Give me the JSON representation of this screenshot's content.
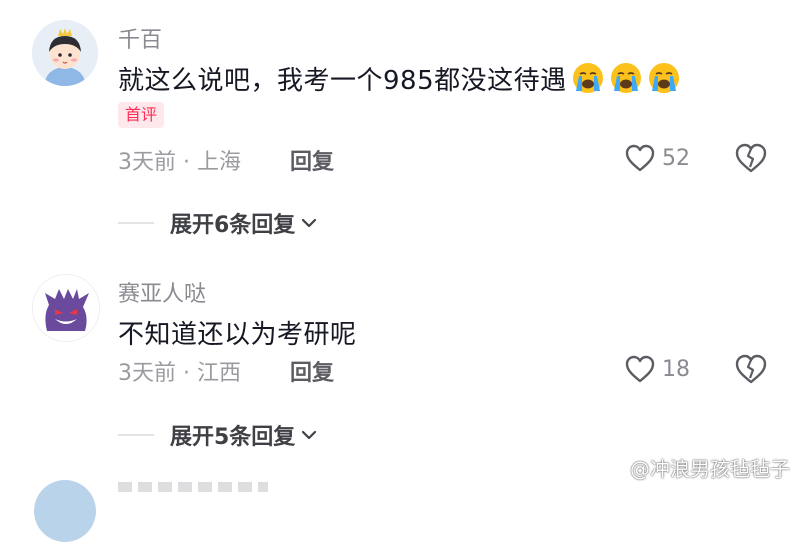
{
  "comments": [
    {
      "username": "千百",
      "text": "就这么说吧，我考一个985都没这待遇",
      "emoji_count": 3,
      "emoji": "loudly-crying-face",
      "badge": "首评",
      "time_location": "3天前 · 上海",
      "reply_label": "回复",
      "likes": "52",
      "expand_label": "展开6条回复"
    },
    {
      "username": "赛亚人哒",
      "text": "不知道还以为考研呢",
      "time_location": "3天前 · 江西",
      "reply_label": "回复",
      "likes": "18",
      "expand_label": "展开5条回复"
    }
  ],
  "watermark": "@冲浪男孩毡毡子",
  "colors": {
    "badge_text": "#fe2c55",
    "badge_bg": "#ffe8ec",
    "muted": "#9a9ba0",
    "primary_text": "#161823"
  },
  "icons": {
    "like": "heart-outline-icon",
    "dislike": "broken-heart-icon",
    "expand": "chevron-down-icon",
    "watermark": "weibo-logo-icon"
  }
}
